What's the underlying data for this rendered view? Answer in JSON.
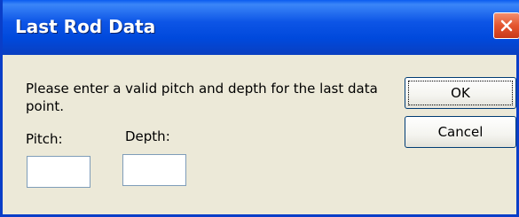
{
  "window": {
    "title": "Last Rod Data"
  },
  "dialog": {
    "message": "Please enter a valid pitch and depth for the last data point.",
    "pitch_label": "Pitch:",
    "depth_label": "Depth:",
    "pitch_value": "",
    "depth_value": "",
    "ok_label": "OK",
    "cancel_label": "Cancel"
  },
  "icons": {
    "close": "close-icon"
  },
  "colors": {
    "titlebar": "#0049DC",
    "close_button": "#E4552E",
    "dialog_background": "#ECE9D8"
  }
}
